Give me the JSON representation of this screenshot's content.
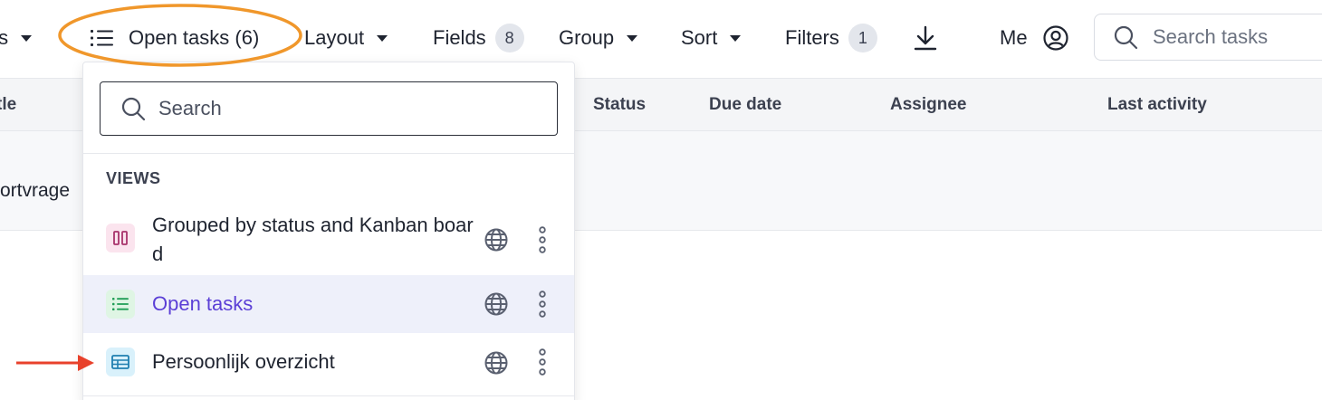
{
  "toolbar": {
    "items_partial": "ts",
    "view_selector_label": "Open tasks (6)",
    "layout_label": "Layout",
    "fields_label": "Fields",
    "fields_count": "8",
    "group_label": "Group",
    "sort_label": "Sort",
    "filters_label": "Filters",
    "filters_count": "1",
    "me_label": "Me",
    "search_placeholder": "Search tasks"
  },
  "table": {
    "columns": [
      "tle",
      "Status",
      "Due date",
      "Assignee",
      "Last activity"
    ],
    "row1_partial": "ortvrage"
  },
  "views_dropdown": {
    "search_placeholder": "Search",
    "section_title": "VIEWS",
    "items": [
      {
        "label": "Grouped by status and Kanban board",
        "icon": "kanban-icon",
        "icon_bg": "#fbe4ee",
        "icon_color": "#a8326b"
      },
      {
        "label": "Open tasks",
        "icon": "list-icon",
        "icon_bg": "#dff5e4",
        "icon_color": "#1f9d55",
        "active": true
      },
      {
        "label": "Persoonlijk overzicht",
        "icon": "table-icon",
        "icon_bg": "#d9f1fb",
        "icon_color": "#1f7fb0"
      }
    ]
  },
  "colors": {
    "annotation_ellipse": "#f0972b",
    "annotation_arrow": "#e8412b",
    "active_text": "#5b3fd6"
  }
}
